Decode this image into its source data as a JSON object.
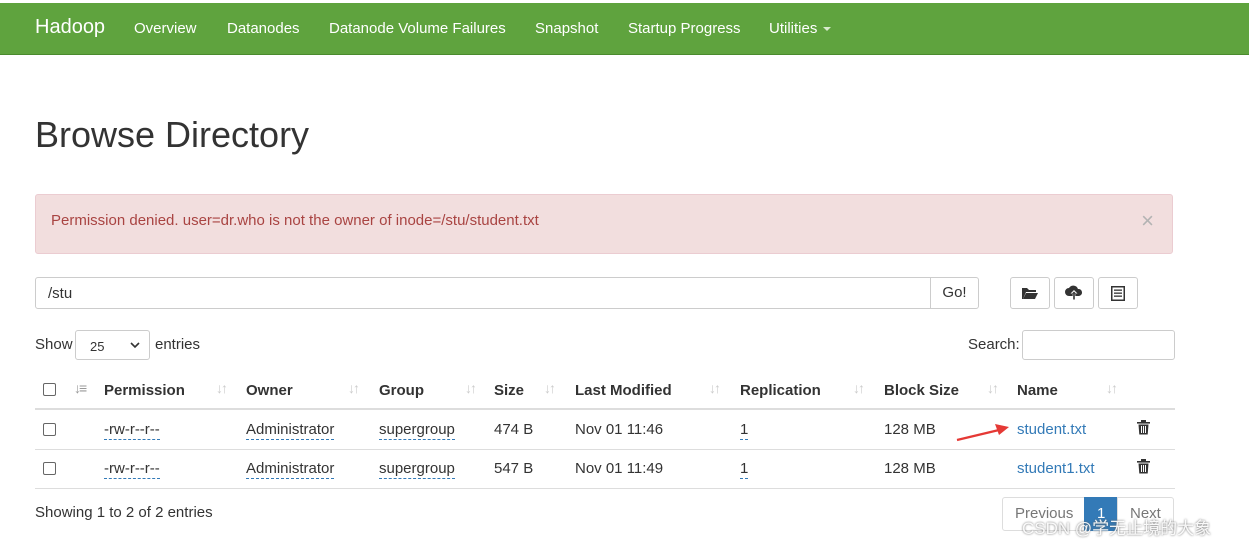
{
  "nav": {
    "brand": "Hadoop",
    "items": [
      "Overview",
      "Datanodes",
      "Datanode Volume Failures",
      "Snapshot",
      "Startup Progress",
      "Utilities"
    ]
  },
  "page_title": "Browse Directory",
  "alert": {
    "message": "Permission denied. user=dr.who is not the owner of inode=/stu/student.txt",
    "close": "×"
  },
  "path": {
    "value": "/stu",
    "go_label": "Go!"
  },
  "toolbar_icons": [
    "folder-open-icon",
    "upload-icon",
    "list-icon"
  ],
  "length": {
    "show_label": "Show",
    "value": "25",
    "entries_label": "entries"
  },
  "search": {
    "label": "Search:"
  },
  "table": {
    "headers": [
      "Permission",
      "Owner",
      "Group",
      "Size",
      "Last Modified",
      "Replication",
      "Block Size",
      "Name"
    ],
    "rows": [
      {
        "permission": "-rw-r--r--",
        "owner": "Administrator",
        "group": "supergroup",
        "size": "474 B",
        "modified": "Nov 01 11:46",
        "replication": "1",
        "block_size": "128 MB",
        "name": "student.txt"
      },
      {
        "permission": "-rw-r--r--",
        "owner": "Administrator",
        "group": "supergroup",
        "size": "547 B",
        "modified": "Nov 01 11:49",
        "replication": "1",
        "block_size": "128 MB",
        "name": "student1.txt"
      }
    ]
  },
  "info": "Showing 1 to 2 of 2 entries",
  "pagination": {
    "previous": "Previous",
    "current": "1",
    "next": "Next"
  },
  "watermark": "CSDN @学无止境的大象",
  "colors": {
    "navbar": "#5fa33e",
    "alert_bg": "#f2dede",
    "alert_text": "#a94442",
    "link": "#337ab7",
    "arrow": "#e53935"
  }
}
